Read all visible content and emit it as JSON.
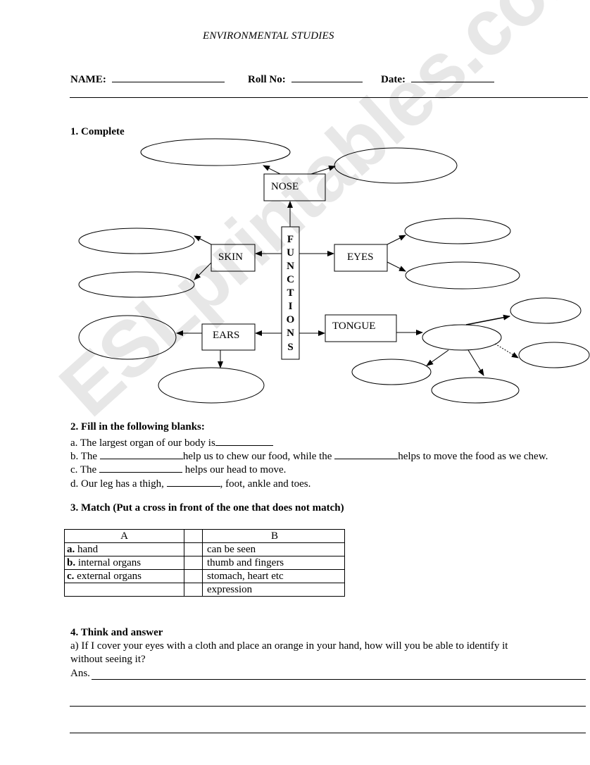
{
  "document": {
    "title": "ENVIRONMENTAL STUDIES",
    "header": {
      "name_label": "NAME:",
      "roll_label": "Roll No:",
      "date_label": "Date:"
    },
    "watermark": "ESLprintables.com"
  },
  "section1": {
    "number": "1",
    "heading": ". Complete",
    "center_label": [
      "F",
      "U",
      "N",
      "C",
      "T",
      "I",
      "O",
      "N",
      "S"
    ],
    "nodes": {
      "nose": "NOSE",
      "skin": "SKIN",
      "eyes": "EYES",
      "ears": "EARS",
      "tongue": "TONGUE"
    }
  },
  "section2": {
    "heading": "2. Fill in the following blanks:",
    "items": {
      "a": {
        "prefix": "a. The largest organ of our body is"
      },
      "b": {
        "prefix": "b. The ",
        "middle": "help us to chew our food, while the ",
        "suffix": "helps to move the food as we chew."
      },
      "c": {
        "prefix": "c. The ",
        "suffix": " helps our head to move."
      },
      "d": {
        "prefix": "d. Our leg has a thigh, ",
        "suffix": ", foot, ankle and toes."
      }
    }
  },
  "section3": {
    "heading": "3. Match (Put a cross in front of the one that does not match)",
    "columns": {
      "a": "A",
      "b": "B"
    },
    "rows": [
      {
        "letter": "a.",
        "a": " hand",
        "b": "can be seen"
      },
      {
        "letter": "b.",
        "a": " internal organs",
        "b": "thumb and fingers"
      },
      {
        "letter": "c.",
        "a": " external organs",
        "b": "stomach, heart etc"
      },
      {
        "letter": "",
        "a": "",
        "b": "expression"
      }
    ]
  },
  "section4": {
    "heading": "4. Think and answer",
    "question_line1": "a) If I cover your eyes with a cloth and place an orange in your hand, how will you be able to identify it",
    "question_line2": "without seeing it?",
    "answer_label": "Ans."
  }
}
